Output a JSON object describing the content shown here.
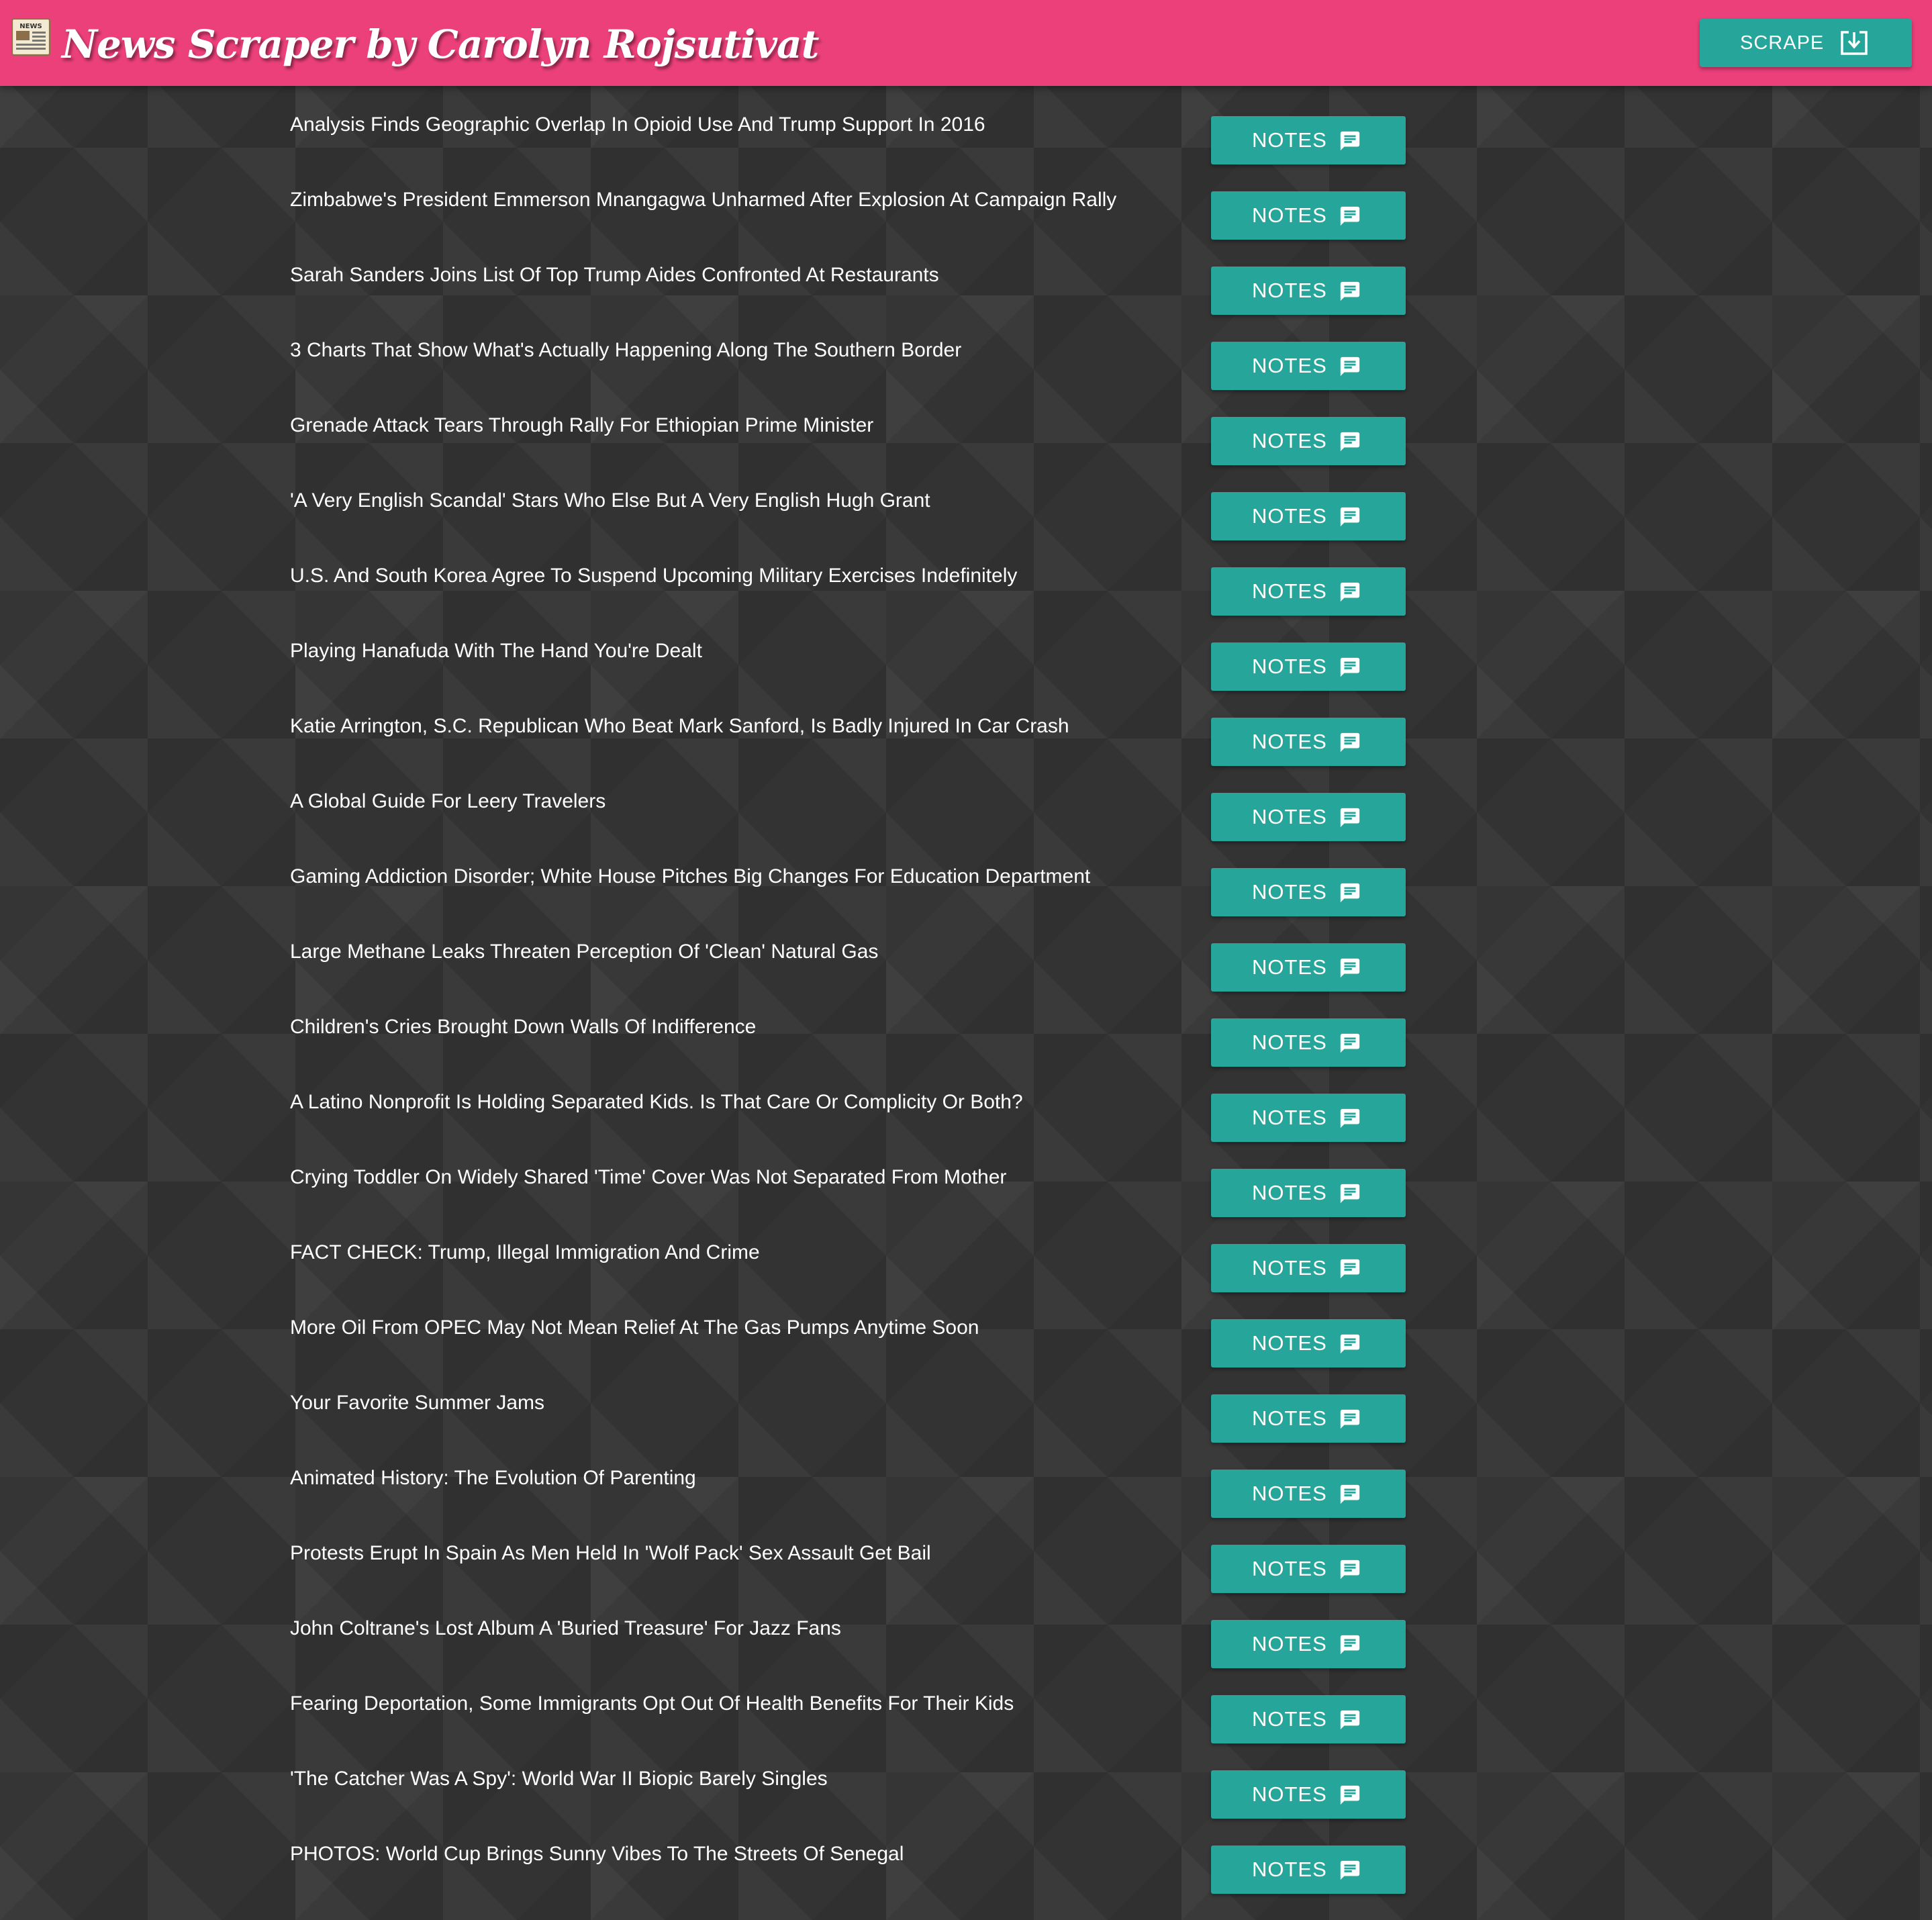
{
  "header": {
    "title": "News Scraper by Carolyn Rojsutivat",
    "logo_icon": "newspaper-icon",
    "logo_text": "NEWS",
    "scrape_label": "SCRAPE",
    "scrape_icon": "download-icon"
  },
  "colors": {
    "navbar": "#ec407a",
    "button": "#26a69a",
    "background": "#333333",
    "text": "#ffffff"
  },
  "notes_label": "NOTES",
  "notes_icon": "comment-icon",
  "articles": [
    "Analysis Finds Geographic Overlap In Opioid Use And Trump Support In 2016",
    "Zimbabwe's President Emmerson Mnangagwa Unharmed After Explosion At Campaign Rally",
    "Sarah Sanders Joins List Of Top Trump Aides Confronted At Restaurants",
    "3 Charts That Show What's Actually Happening Along The Southern Border",
    "Grenade Attack Tears Through Rally For Ethiopian Prime Minister",
    "'A Very English Scandal' Stars Who Else But A Very English Hugh Grant",
    "U.S. And South Korea Agree To Suspend Upcoming Military Exercises Indefinitely",
    "Playing Hanafuda With The Hand You're Dealt",
    "Katie Arrington, S.C. Republican Who Beat Mark Sanford, Is Badly Injured In Car Crash",
    "A Global Guide For Leery Travelers",
    "Gaming Addiction Disorder; White House Pitches Big Changes For Education Department",
    "Large Methane Leaks Threaten Perception Of 'Clean' Natural Gas",
    "Children's Cries Brought Down Walls Of Indifference",
    "A Latino Nonprofit Is Holding Separated Kids. Is That Care Or Complicity Or Both?",
    "Crying Toddler On Widely Shared 'Time' Cover Was Not Separated From Mother",
    "FACT CHECK: Trump, Illegal Immigration And Crime",
    "More Oil From OPEC May Not Mean Relief At The Gas Pumps Anytime Soon",
    "Your Favorite Summer Jams",
    "Animated History: The Evolution Of Parenting",
    "Protests Erupt In Spain As Men Held In 'Wolf Pack' Sex Assault Get Bail",
    "John Coltrane's Lost Album A 'Buried Treasure' For Jazz Fans",
    "Fearing Deportation, Some Immigrants Opt Out Of Health Benefits For Their Kids",
    "'The Catcher Was A Spy': World War II Biopic Barely Singles",
    "PHOTOS: World Cup Brings Sunny Vibes To The Streets Of Senegal"
  ]
}
